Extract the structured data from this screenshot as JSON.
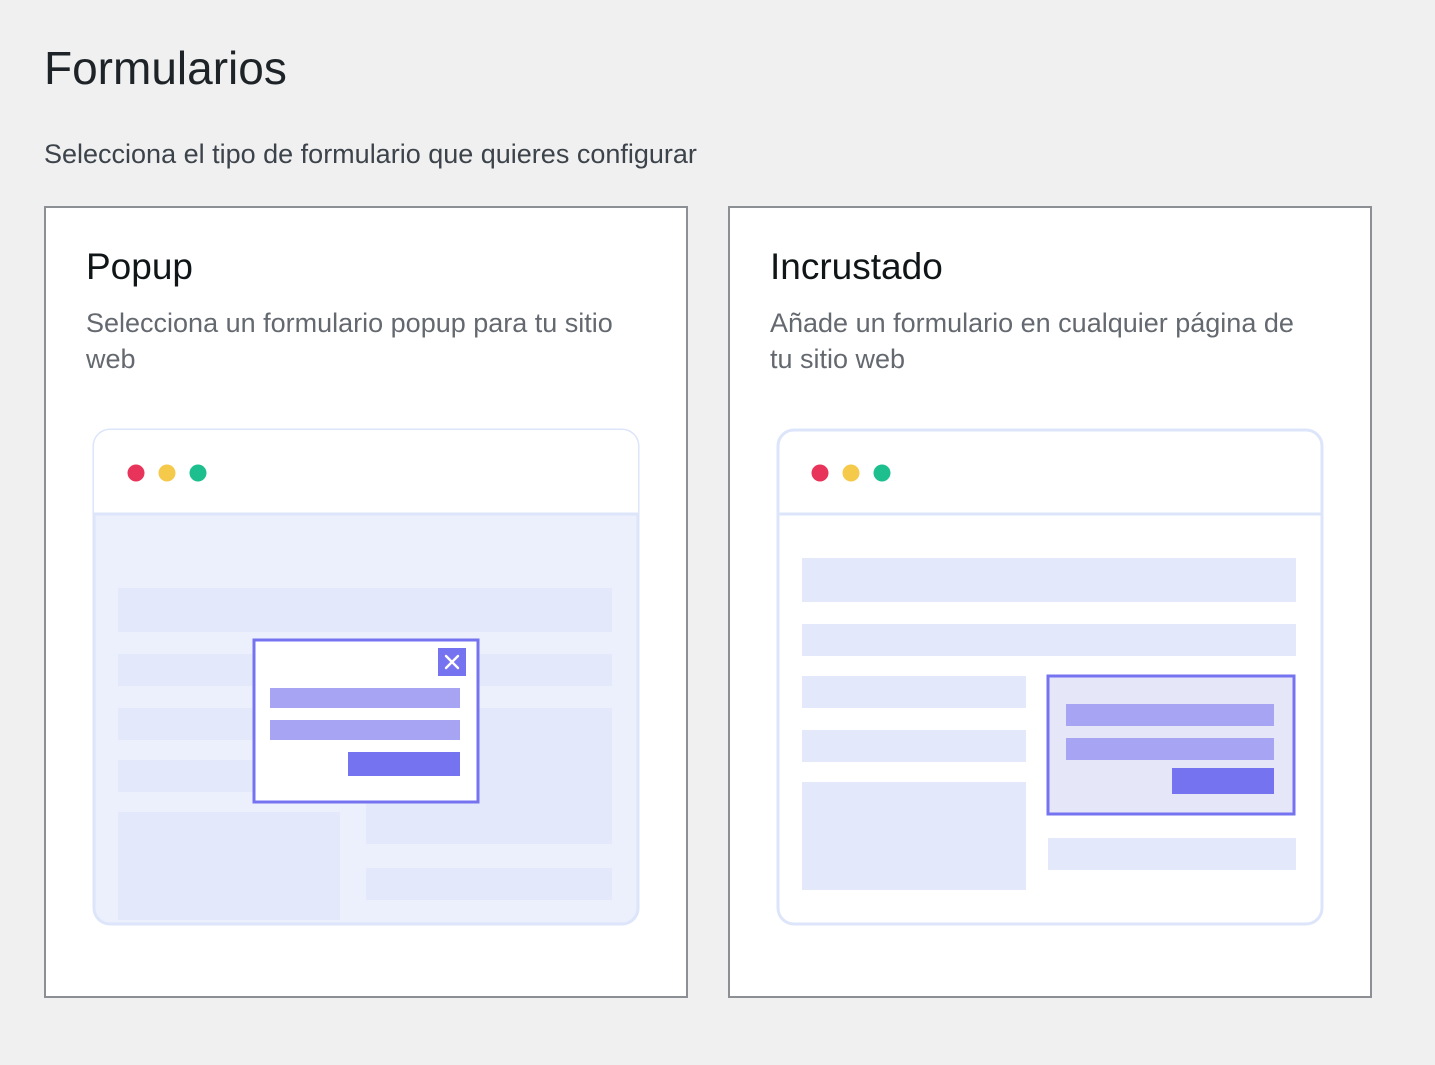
{
  "page": {
    "title": "Formularios",
    "subtitle": "Selecciona el tipo de formulario que quieres configurar"
  },
  "cards": [
    {
      "title": "Popup",
      "description": "Selecciona un formulario popup para tu sitio web",
      "illustration": "popup-form-illustration"
    },
    {
      "title": "Incrustado",
      "description": "Añade un formulario en cualquier página de tu sitio web",
      "illustration": "embedded-form-illustration"
    }
  ],
  "colors": {
    "background": "#f0f0f1",
    "card_border": "#8c8f94",
    "dot_red": "#e8345a",
    "dot_yellow": "#f5c94a",
    "dot_green": "#1dbf8f",
    "accent": "#7673f0"
  }
}
